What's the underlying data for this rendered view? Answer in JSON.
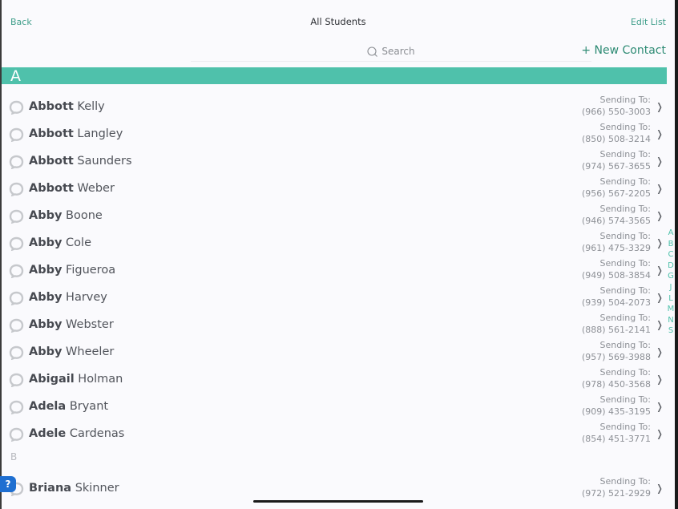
{
  "nav": {
    "back_label": "Back",
    "title": "All Students",
    "edit_label": "Edit List"
  },
  "search": {
    "placeholder": "Search",
    "icon": "search-icon"
  },
  "new_contact_label": "+ New Contact",
  "colors": {
    "accent": "#4fc1ab",
    "link": "#3f9e8a"
  },
  "sections": [
    {
      "letter": "A",
      "contacts": [
        {
          "first": "Abbott",
          "last": "Kelly",
          "send_label": "Sending To:",
          "phone": "(966) 550-3003"
        },
        {
          "first": "Abbott",
          "last": "Langley",
          "send_label": "Sending To:",
          "phone": "(850) 508-3214"
        },
        {
          "first": "Abbott",
          "last": "Saunders",
          "send_label": "Sending To:",
          "phone": "(974) 567-3655"
        },
        {
          "first": "Abbott",
          "last": "Weber",
          "send_label": "Sending To:",
          "phone": "(956) 567-2205"
        },
        {
          "first": "Abby",
          "last": "Boone",
          "send_label": "Sending To:",
          "phone": "(946) 574-3565"
        },
        {
          "first": "Abby",
          "last": "Cole",
          "send_label": "Sending To:",
          "phone": "(961) 475-3329"
        },
        {
          "first": "Abby",
          "last": "Figueroa",
          "send_label": "Sending To:",
          "phone": "(949) 508-3854"
        },
        {
          "first": "Abby",
          "last": "Harvey",
          "send_label": "Sending To:",
          "phone": "(939) 504-2073"
        },
        {
          "first": "Abby",
          "last": "Webster",
          "send_label": "Sending To:",
          "phone": "(888) 561-2141"
        },
        {
          "first": "Abby",
          "last": "Wheeler",
          "send_label": "Sending To:",
          "phone": "(957) 569-3988"
        },
        {
          "first": "Abigail",
          "last": "Holman",
          "send_label": "Sending To:",
          "phone": "(978) 450-3568"
        },
        {
          "first": "Adela",
          "last": "Bryant",
          "send_label": "Sending To:",
          "phone": "(909) 435-3195"
        },
        {
          "first": "Adele",
          "last": "Cardenas",
          "send_label": "Sending To:",
          "phone": "(854) 451-3771"
        }
      ]
    },
    {
      "letter": "B",
      "contacts": [
        {
          "first": "Briana",
          "last": "Skinner",
          "send_label": "Sending To:",
          "phone": "(972) 521-2929"
        }
      ]
    }
  ],
  "index_letters": [
    "A",
    "B",
    "C",
    "D",
    "G",
    "J",
    "L",
    "M",
    "N",
    "S"
  ],
  "help_label": "?"
}
